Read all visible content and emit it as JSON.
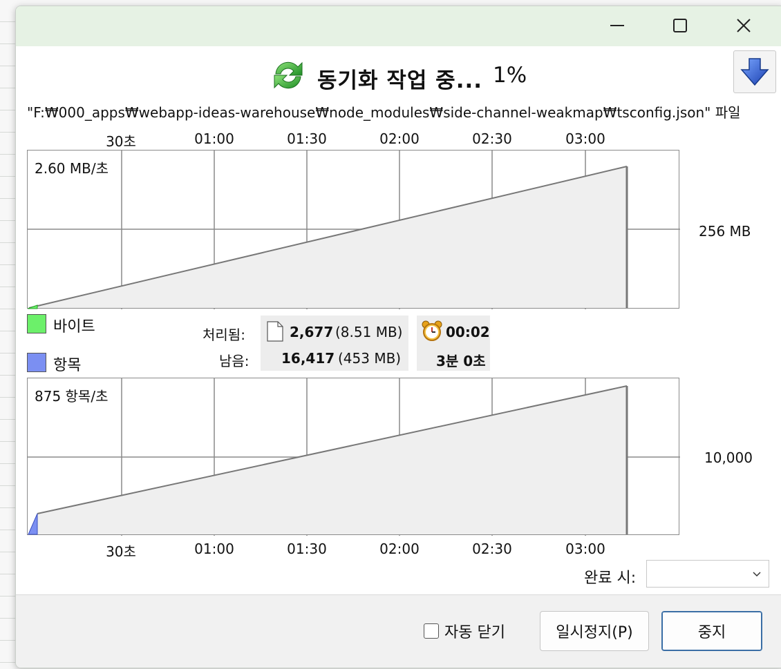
{
  "window": {
    "title": "동기화 작업 중...",
    "percent": "1%",
    "progress_fraction": 0.01,
    "controls": {
      "minimize": "—",
      "maximize": "☐",
      "close": "✕"
    }
  },
  "file_line": "\"F:₩000_apps₩webapp-ideas-warehouse₩node_modules₩side-channel-weakmap₩tsconfig.json\" 파일",
  "axis_ticks": [
    "30초",
    "01:00",
    "01:30",
    "02:00",
    "02:30",
    "03:00"
  ],
  "bytes_graph": {
    "rate": "2.60 MB/초",
    "total": "256 MB",
    "fill_color": "#f0f0f0",
    "start_color": "#66ee66"
  },
  "items_graph": {
    "rate": "875 항목/초",
    "total": "10,000",
    "fill_color": "#f0f0f0",
    "start_color": "#7b8ff2"
  },
  "legend": {
    "bytes": {
      "label": "바이트",
      "color": "#6cf06a"
    },
    "items": {
      "label": "항목",
      "color": "#7b8ff2"
    }
  },
  "stats": {
    "processed_label": "처리됨:",
    "processed_count": "2,677",
    "processed_size": "(8.51 MB)",
    "remaining_label": "남음:",
    "remaining_count": "16,417",
    "remaining_size": "(453 MB)",
    "elapsed": "00:02",
    "remaining_time": "3분 0초"
  },
  "completion": {
    "label": "완료 시:",
    "value": ""
  },
  "footer": {
    "auto_close_label": "자동 닫기",
    "auto_close_checked": false,
    "pause_button": "일시정지(P)",
    "stop_button": "중지"
  },
  "icons": {
    "sync": "sync-arrows-icon",
    "download": "down-arrow-icon",
    "file": "file-icon",
    "clock": "alarm-clock-icon"
  }
}
